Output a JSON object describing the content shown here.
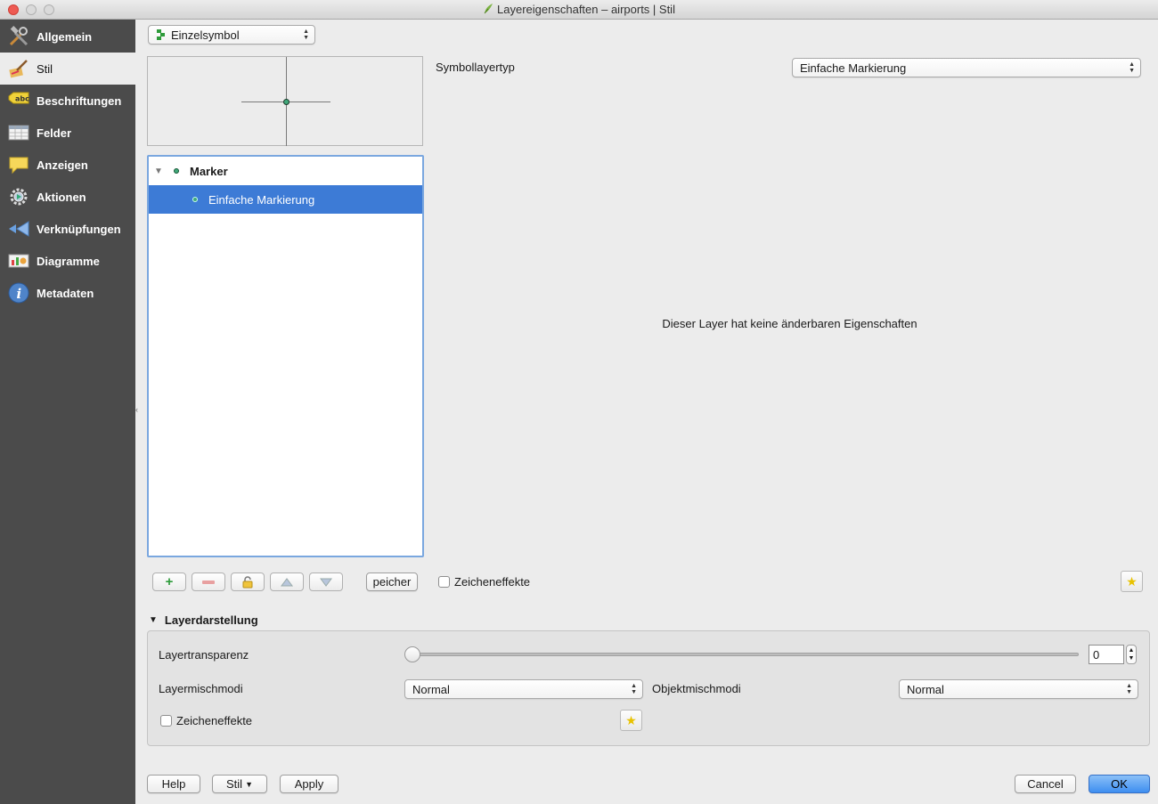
{
  "window": {
    "title": "Layereigenschaften – airports | Stil"
  },
  "sidebar": {
    "items": [
      {
        "label": "Allgemein",
        "icon": "tools-icon",
        "active": false
      },
      {
        "label": "Stil",
        "icon": "brush-icon",
        "active": true
      },
      {
        "label": "Beschriftungen",
        "icon": "abc-label-icon",
        "active": false
      },
      {
        "label": "Felder",
        "icon": "table-icon",
        "active": false
      },
      {
        "label": "Anzeigen",
        "icon": "speech-bubble-icon",
        "active": false
      },
      {
        "label": "Aktionen",
        "icon": "gear-icon",
        "active": false
      },
      {
        "label": "Verknüpfungen",
        "icon": "join-icon",
        "active": false
      },
      {
        "label": "Diagramme",
        "icon": "diagram-icon",
        "active": false
      },
      {
        "label": "Metadaten",
        "icon": "info-icon",
        "active": false
      }
    ]
  },
  "style": {
    "renderer": "Einzelsymbol",
    "tree": {
      "root": "Marker",
      "child": "Einfache Markierung"
    },
    "symbol_layer_type_label": "Symbollayertyp",
    "symbol_layer_type_value": "Einfache Markierung",
    "no_properties_message": "Dieser Layer hat keine änderbaren Eigenschaften",
    "save_button": "peicher",
    "draw_effects_label": "Zeicheneffekte"
  },
  "layer_rendering": {
    "title": "Layerdarstellung",
    "transparency_label": "Layertransparenz",
    "transparency_value": "0",
    "blend_mode_label": "Layermischmodi",
    "blend_mode_value": "Normal",
    "feature_blend_label": "Objektmischmodi",
    "feature_blend_value": "Normal",
    "draw_effects_label": "Zeicheneffekte"
  },
  "footer": {
    "help": "Help",
    "style": "Stil",
    "apply": "Apply",
    "cancel": "Cancel",
    "ok": "OK"
  },
  "colors": {
    "sidebar_bg": "#4b4b4b",
    "selection": "#3d7bd6",
    "marker_fill": "#41a87a"
  }
}
